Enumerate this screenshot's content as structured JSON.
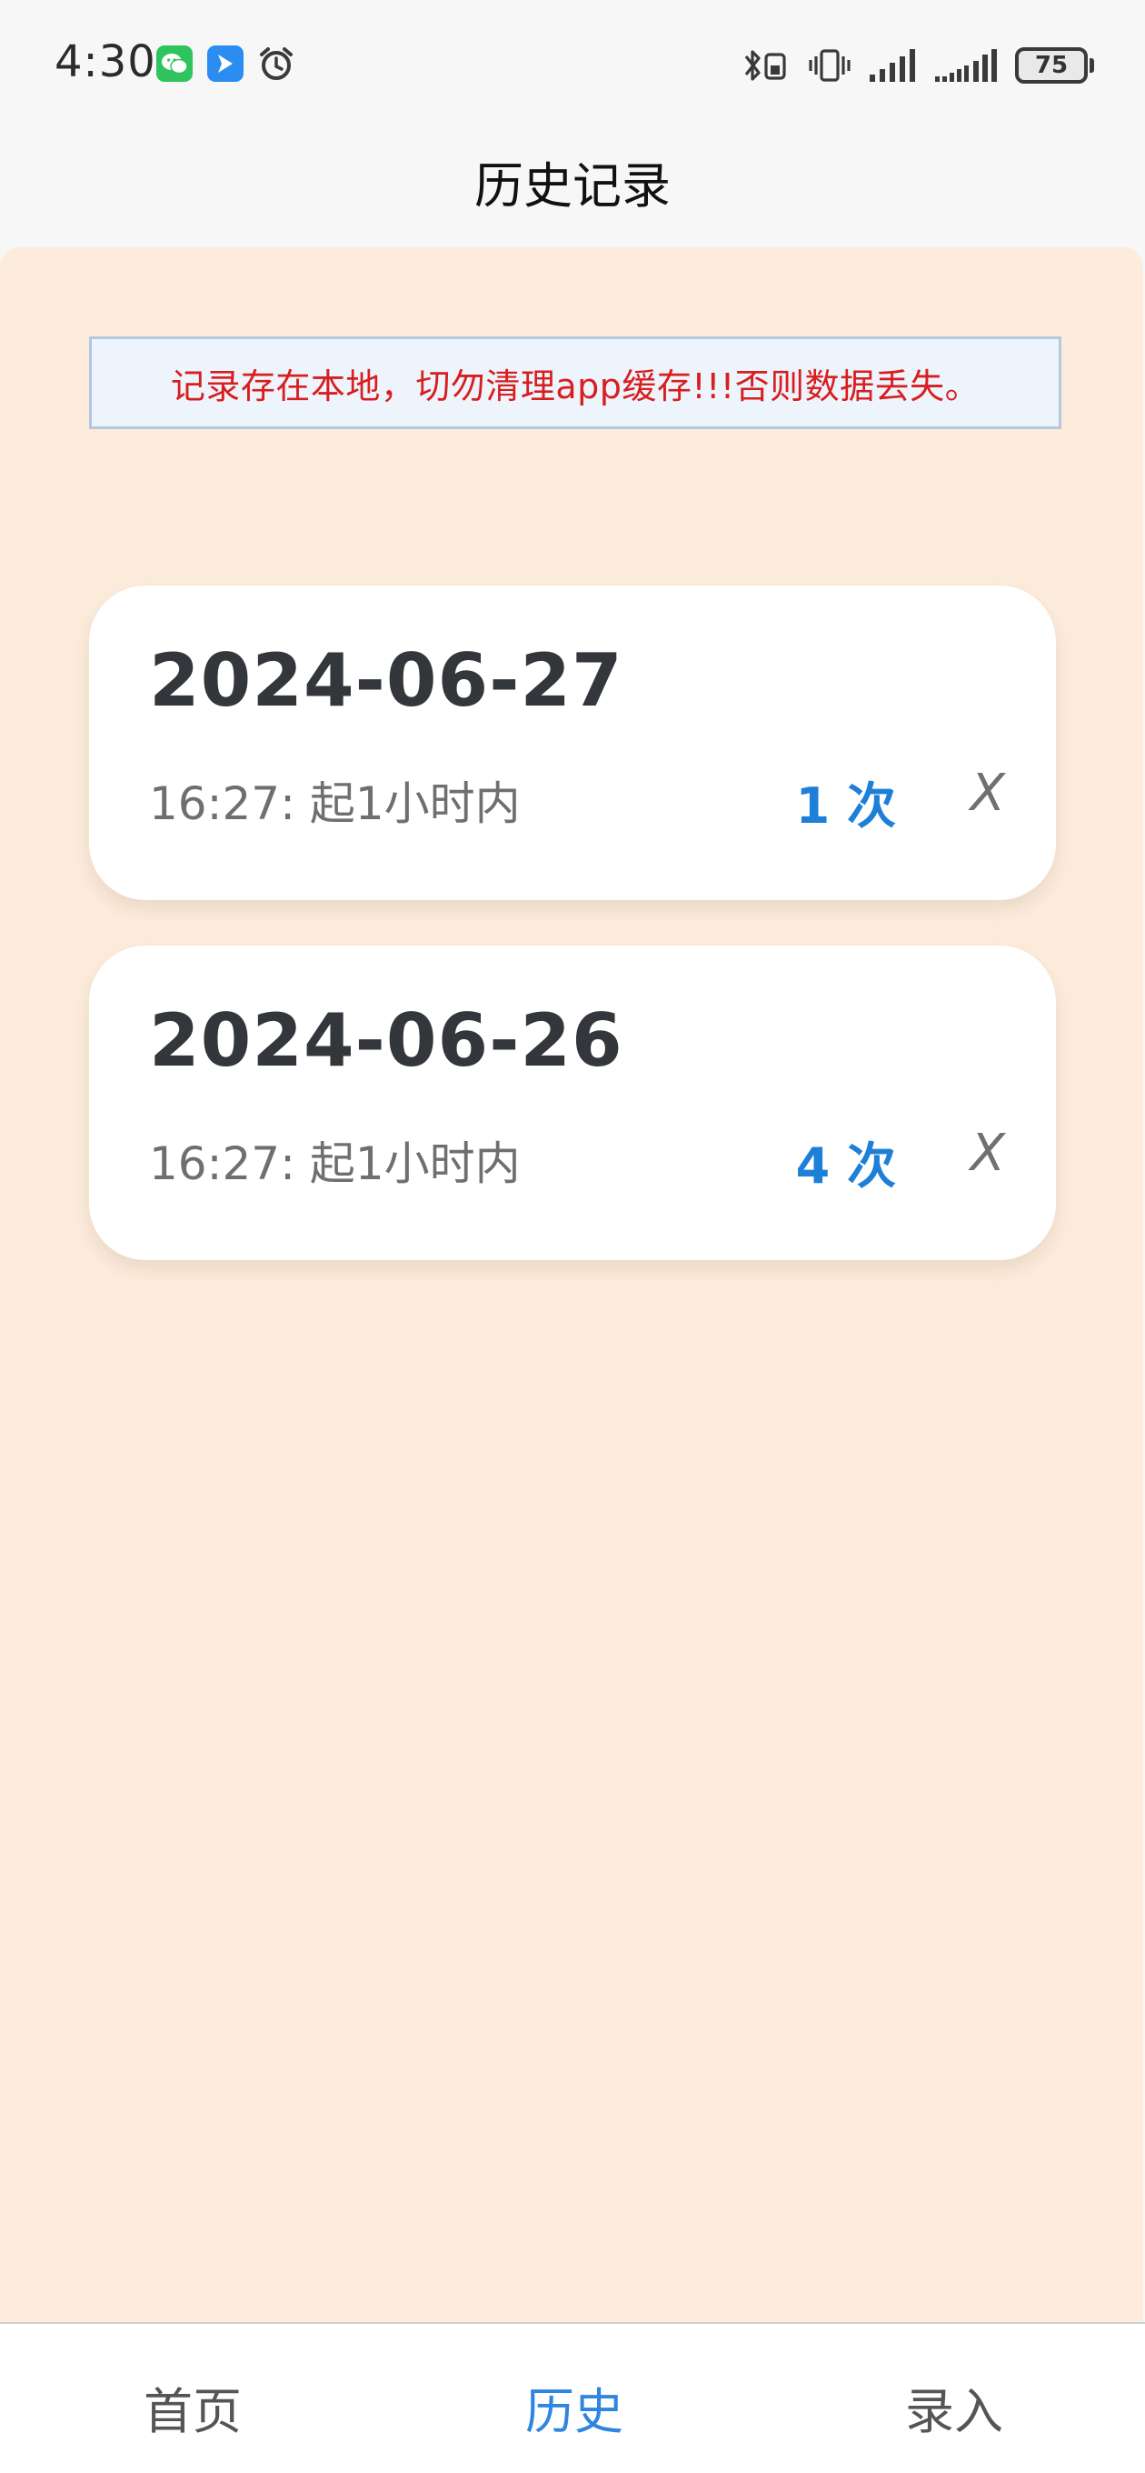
{
  "status_bar": {
    "time": "4:30",
    "battery": "75",
    "icons": [
      "wechat-icon",
      "feishu-icon",
      "alarm-icon",
      "bluetooth-icon",
      "vibrate-icon",
      "signal-icon",
      "signal-2-icon",
      "battery-icon"
    ]
  },
  "header": {
    "title": "历史记录"
  },
  "notice": {
    "text": "记录存在本地，切勿清理app缓存!!!否则数据丢失。",
    "color": "#d81e1e"
  },
  "records": [
    {
      "date": "2024-06-27",
      "detail": "16:27: 起1小时内",
      "count": "1 次",
      "delete": "X"
    },
    {
      "date": "2024-06-26",
      "detail": "16:27: 起1小时内",
      "count": "4 次",
      "delete": "X"
    }
  ],
  "nav": {
    "tabs": [
      {
        "label": "首页"
      },
      {
        "label": "历史",
        "active": true
      },
      {
        "label": "录入"
      }
    ],
    "active_color": "#2f86e0"
  },
  "colors": {
    "content_bg": "#fdecdc",
    "count_color": "#1e7fd8"
  }
}
